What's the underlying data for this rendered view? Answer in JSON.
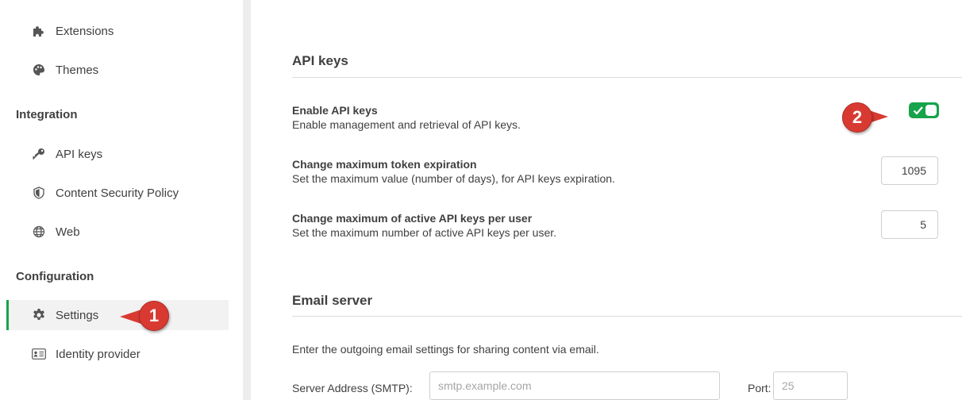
{
  "sidebar": {
    "items_top": [
      {
        "label": "Extensions",
        "icon": "puzzle-icon"
      },
      {
        "label": "Themes",
        "icon": "palette-icon"
      }
    ],
    "sections": [
      {
        "title": "Integration",
        "items": [
          {
            "label": "API keys",
            "icon": "key-icon"
          },
          {
            "label": "Content Security Policy",
            "icon": "shield-icon"
          },
          {
            "label": "Web",
            "icon": "globe-icon"
          }
        ]
      },
      {
        "title": "Configuration",
        "items": [
          {
            "label": "Settings",
            "icon": "gear-icon",
            "active": true
          },
          {
            "label": "Identity provider",
            "icon": "id-card-icon"
          }
        ]
      }
    ]
  },
  "main": {
    "api_keys": {
      "heading": "API keys",
      "enable": {
        "title": "Enable API keys",
        "description": "Enable management and retrieval of API keys.",
        "enabled": true
      },
      "max_expiration": {
        "title": "Change maximum token expiration",
        "description": "Set the maximum value (number of days), for API keys expiration.",
        "value": "1095"
      },
      "max_active": {
        "title": "Change maximum of active API keys per user",
        "description": "Set the maximum number of active API keys per user.",
        "value": "5"
      }
    },
    "email_server": {
      "heading": "Email server",
      "intro": "Enter the outgoing email settings for sharing content via email.",
      "server_label": "Server Address (SMTP):",
      "server_placeholder": "smtp.example.com",
      "port_label": "Port:",
      "port_placeholder": "25"
    }
  },
  "callouts": [
    "1",
    "2"
  ],
  "colors": {
    "accent_green": "#16a34a",
    "callout_red": "#d83a32"
  }
}
